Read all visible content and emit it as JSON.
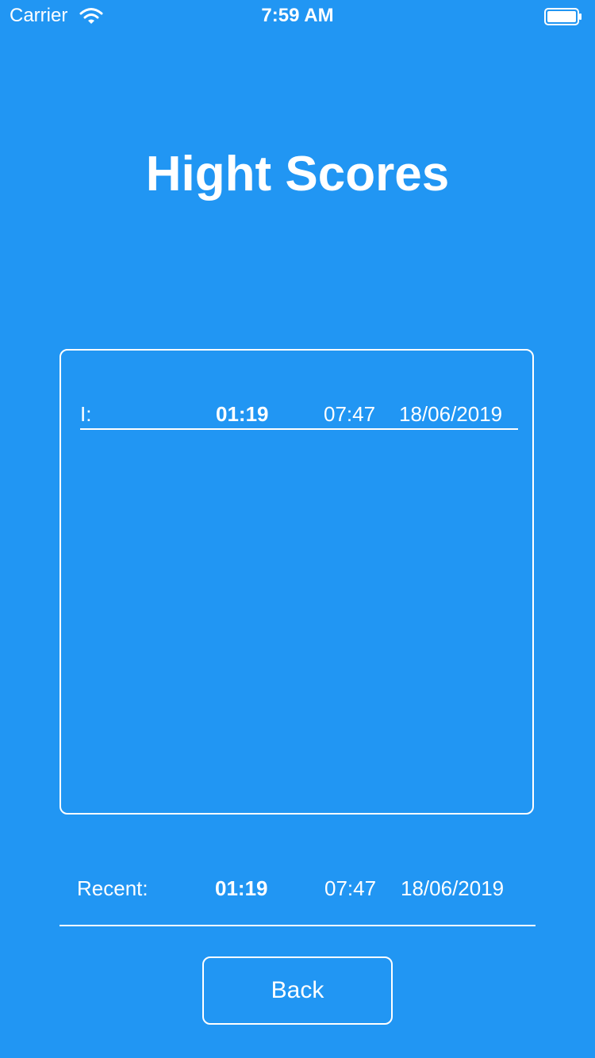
{
  "status_bar": {
    "carrier": "Carrier",
    "time": "7:59 AM",
    "wifi_icon": "wifi-icon",
    "battery_icon": "battery-icon"
  },
  "title": "Hight Scores",
  "high_scores": [
    {
      "rank": "I:",
      "score": "01:19",
      "time": "07:47",
      "date": "18/06/2019"
    }
  ],
  "recent": {
    "label": "Recent:",
    "score": "01:19",
    "time": "07:47",
    "date": "18/06/2019"
  },
  "back_button": {
    "label": "Back"
  },
  "colors": {
    "background": "#2196F3",
    "foreground": "#FFFFFF"
  }
}
